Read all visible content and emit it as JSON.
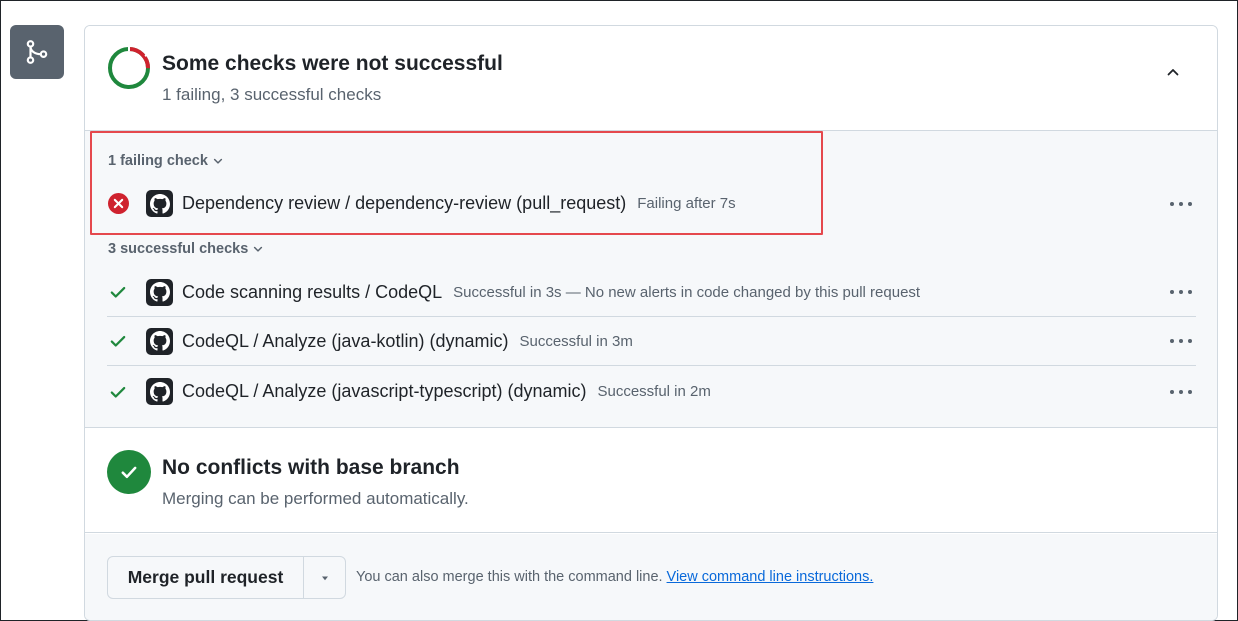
{
  "merge_icon": "git-merge-icon",
  "checks_header": {
    "title": "Some checks were not successful",
    "subtitle": "1 failing, 3 successful checks",
    "status_ring_icon": "check-status-ring-icon",
    "collapse_icon": "chevron-up-icon"
  },
  "failing_group": {
    "label": "1 failing check",
    "checks": [
      {
        "name": "Dependency review / dependency-review (pull_request)",
        "meta": "Failing after 7s",
        "status": "failure",
        "status_icon": "x-circle-fill-icon",
        "avatar_icon": "github-mark-icon"
      }
    ]
  },
  "successful_group": {
    "label": "3 successful checks",
    "checks": [
      {
        "name": "Code scanning results / CodeQL",
        "meta": "Successful in 3s — No new alerts in code changed by this pull request",
        "status": "success",
        "status_icon": "check-icon",
        "avatar_icon": "github-mark-icon"
      },
      {
        "name": "CodeQL / Analyze (java-kotlin) (dynamic)",
        "meta": "Successful in 3m",
        "status": "success",
        "status_icon": "check-icon",
        "avatar_icon": "github-mark-icon"
      },
      {
        "name": "CodeQL / Analyze (javascript-typescript) (dynamic)",
        "meta": "Successful in 2m",
        "status": "success",
        "status_icon": "check-icon",
        "avatar_icon": "github-mark-icon"
      }
    ]
  },
  "conflicts": {
    "title": "No conflicts with base branch",
    "subtitle": "Merging can be performed automatically.",
    "icon": "check-circle-fill-icon"
  },
  "merge": {
    "button_label": "Merge pull request",
    "dropdown_icon": "triangle-down-icon",
    "hint": "You can also merge this with the command line.",
    "link": "View command line instructions."
  },
  "colors": {
    "success": "#1f883d",
    "failure": "#cf222e",
    "highlight": "#e5484d",
    "link": "#0969da",
    "muted_text": "#59636e",
    "border": "#d1d9e0",
    "subtle_bg": "#f6f8fa"
  }
}
